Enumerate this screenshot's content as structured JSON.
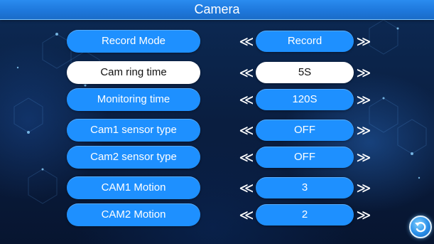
{
  "header": {
    "title": "Camera"
  },
  "rows": [
    {
      "label": "Record Mode",
      "value": "Record",
      "active": false
    },
    {
      "label": "Cam ring time",
      "value": "5S",
      "active": true
    },
    {
      "label": "Monitoring time",
      "value": "120S",
      "active": false
    },
    {
      "label": "Cam1 sensor type",
      "value": "OFF",
      "active": false
    },
    {
      "label": "Cam2 sensor type",
      "value": "OFF",
      "active": false
    },
    {
      "label": "CAM1 Motion",
      "value": "3",
      "active": false
    },
    {
      "label": "CAM2 Motion",
      "value": "2",
      "active": false
    }
  ],
  "arrows": {
    "left": "≪",
    "right": "≫"
  },
  "icons": {
    "back": "return-arrow-icon"
  },
  "colors": {
    "pill": "#1e90ff",
    "pill_active": "#ffffff",
    "header": "#1e78dc",
    "background": "#0a1f3f"
  }
}
